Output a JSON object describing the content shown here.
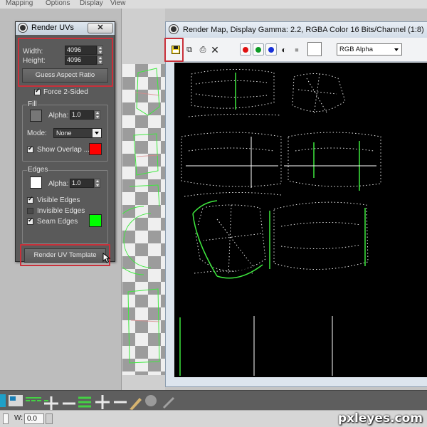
{
  "menubar": {
    "items": [
      {
        "label": "Mapping"
      },
      {
        "label": "Options"
      },
      {
        "label": "Display"
      },
      {
        "label": "View"
      }
    ]
  },
  "render_uvs": {
    "title": "Render UVs",
    "width_label": "Width:",
    "width_value": "4096",
    "height_label": "Height:",
    "height_value": "4096",
    "guess_aspect_label": "Guess Aspect Ratio",
    "force_two_sided_label": "Force 2-Sided",
    "fill_group": "Fill",
    "fill_alpha_label": "Alpha:",
    "fill_alpha_value": "1.0",
    "mode_label": "Mode:",
    "mode_value": "None",
    "show_overlap_label": "Show Overlap ...",
    "overlap_color": "#ff0000",
    "edges_group": "Edges",
    "edges_alpha_label": "Alpha:",
    "edges_alpha_value": "1.0",
    "visible_edges_label": "Visible Edges",
    "invisible_edges_label": "Invisible Edges",
    "seam_edges_label": "Seam Edges",
    "seam_color": "#00ff00",
    "render_template_label": "Render UV Template"
  },
  "render_map": {
    "title": "Render Map, Display Gamma: 2.2, RGBA Color 16 Bits/Channel (1:8)",
    "channel_select": "RGB Alpha",
    "channel_colors": {
      "red": "#e01010",
      "green": "#0c9a24",
      "blue": "#1630d8"
    }
  },
  "highlight_color": "#c9303a",
  "status": {
    "w_label": "W:",
    "w_value": "0.0"
  },
  "watermark": "pxleyes.com"
}
